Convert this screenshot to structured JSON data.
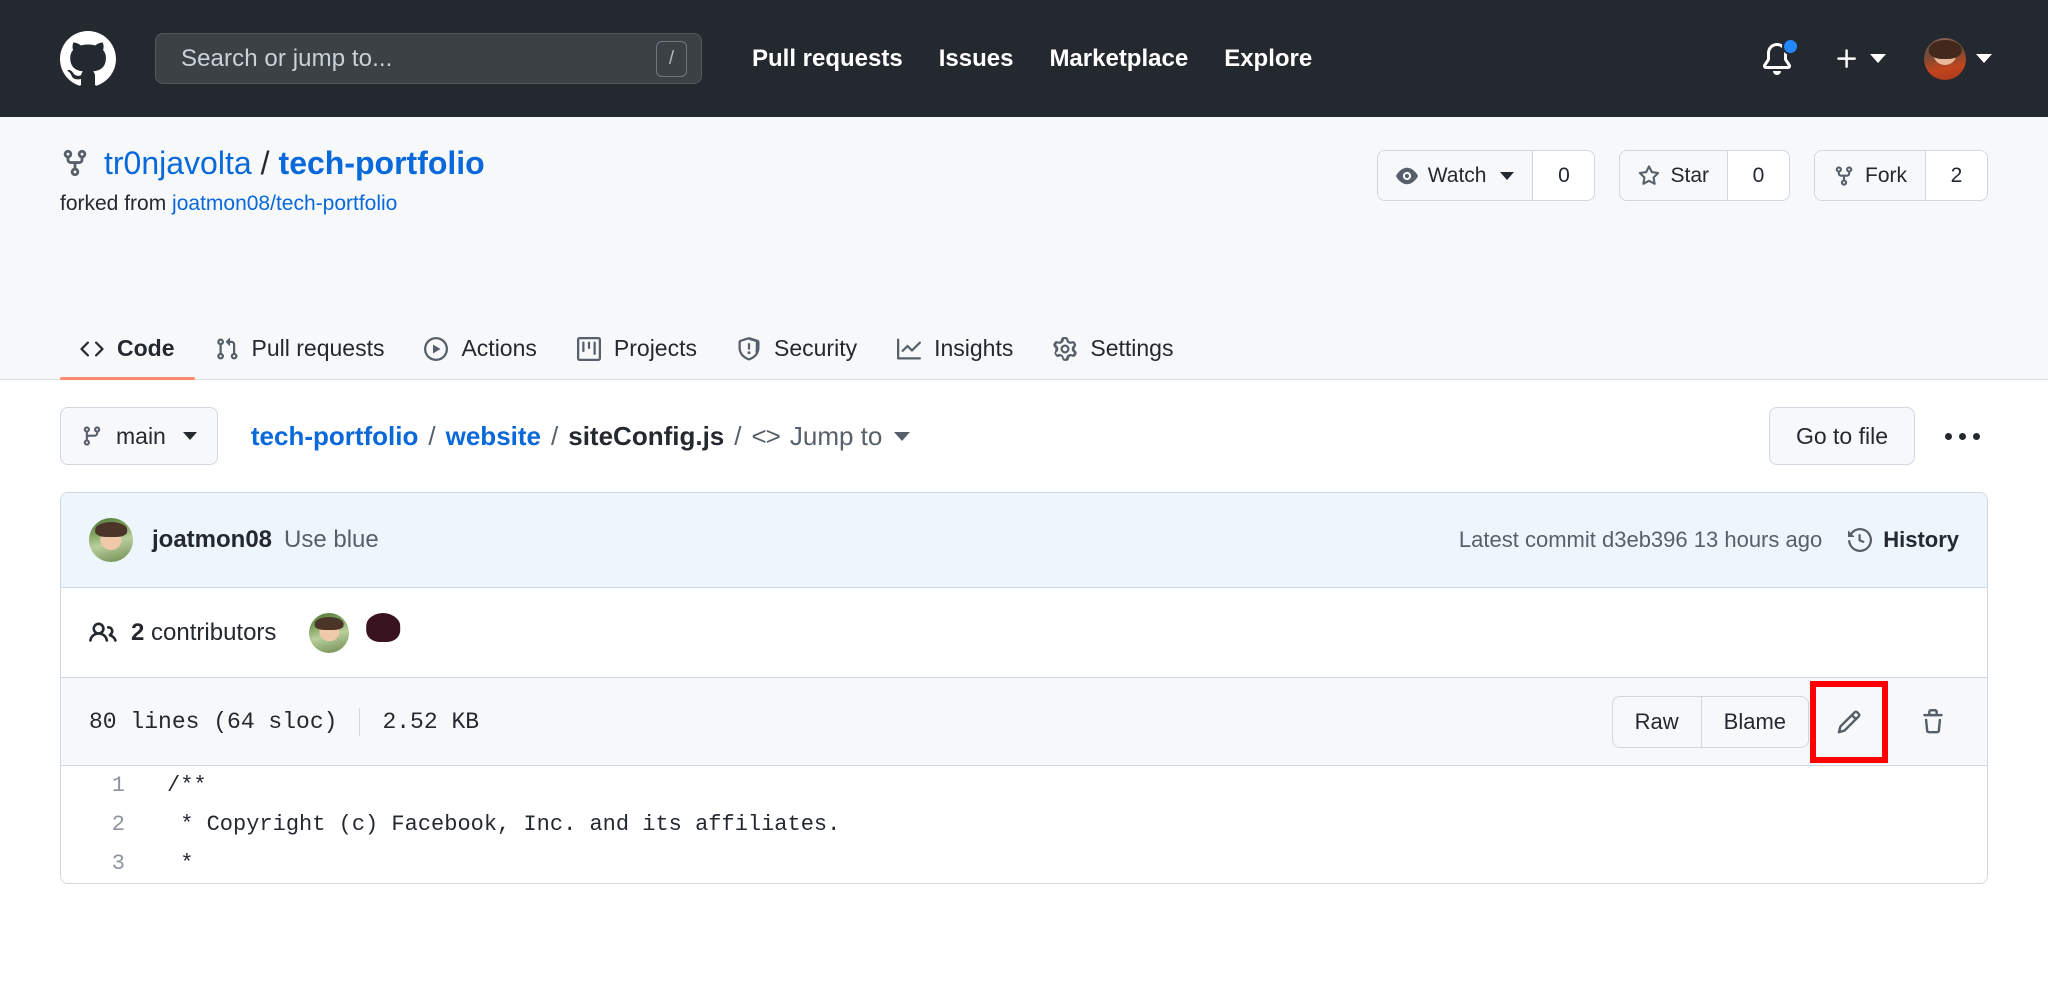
{
  "header": {
    "logo_icon": "github-mark-icon",
    "search": {
      "placeholder": "Search or jump to...",
      "shortcut": "/"
    },
    "nav": [
      {
        "label": "Pull requests"
      },
      {
        "label": "Issues"
      },
      {
        "label": "Marketplace"
      },
      {
        "label": "Explore"
      }
    ],
    "notifications_icon": "bell-icon",
    "has_unread": true,
    "create_new_icon": "plus-icon",
    "account_icon": "avatar"
  },
  "repo": {
    "icon": "repo-forked-icon",
    "owner": "tr0njavolta",
    "separator": "/",
    "name": "tech-portfolio",
    "forked_from_label": "forked from",
    "forked_from_repo": "joatmon08/tech-portfolio",
    "actions": [
      {
        "label": "Watch",
        "count": "0",
        "icon": "eye-icon",
        "has_caret": true
      },
      {
        "label": "Star",
        "count": "0",
        "icon": "star-icon",
        "has_caret": false
      },
      {
        "label": "Fork",
        "count": "2",
        "icon": "repo-forked-icon",
        "has_caret": false
      }
    ],
    "tabs": [
      {
        "label": "Code",
        "icon": "code-icon",
        "active": true
      },
      {
        "label": "Pull requests",
        "icon": "git-pull-request-icon",
        "active": false
      },
      {
        "label": "Actions",
        "icon": "play-icon",
        "active": false
      },
      {
        "label": "Projects",
        "icon": "project-icon",
        "active": false
      },
      {
        "label": "Security",
        "icon": "shield-icon",
        "active": false
      },
      {
        "label": "Insights",
        "icon": "graph-icon",
        "active": false
      },
      {
        "label": "Settings",
        "icon": "gear-icon",
        "active": false
      }
    ]
  },
  "file_nav": {
    "branch": "main",
    "branch_icon": "git-branch-icon",
    "breadcrumb": {
      "repo": "tech-portfolio",
      "folder": "website",
      "file": "siteConfig.js"
    },
    "jump_to": "Jump to",
    "go_to_file": "Go to file",
    "more_options_icon": "kebab-horizontal-icon"
  },
  "commit": {
    "author": "joatmon08",
    "message": "Use blue",
    "latest_label": "Latest commit",
    "sha": "d3eb396",
    "time": "13 hours ago",
    "history_label": "History",
    "history_icon": "history-icon"
  },
  "contributors": {
    "icon": "people-icon",
    "count": "2",
    "label": "contributors",
    "avatars": [
      "joatmon08-avatar",
      "contributor-2-avatar"
    ]
  },
  "file_meta": {
    "lines": "80 lines (64 sloc)",
    "size": "2.52 KB",
    "raw_label": "Raw",
    "blame_label": "Blame",
    "edit_icon": "pencil-icon",
    "delete_icon": "trash-icon",
    "edit_highlight_color": "#ff0000"
  },
  "code": {
    "lines": [
      {
        "num": "1",
        "text": "/**"
      },
      {
        "num": "2",
        "text": " * Copyright (c) Facebook, Inc. and its affiliates."
      },
      {
        "num": "3",
        "text": " *"
      }
    ]
  },
  "colors": {
    "header_bg": "#24292f",
    "accent_blue": "#0969da",
    "tab_underline": "#fd8c73",
    "commit_bar_bg": "#eef6fd"
  }
}
